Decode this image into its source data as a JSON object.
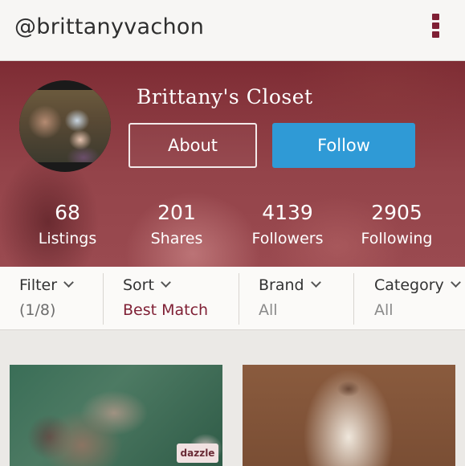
{
  "header": {
    "username": "@brittanyvachon",
    "menu_icon": "kebab-menu-icon"
  },
  "profile": {
    "closet_title": "Brittany's Closet",
    "about_label": "About",
    "follow_label": "Follow",
    "follow_color": "#2f9ad6",
    "accent_color": "#7f1f34"
  },
  "stats": [
    {
      "value": "68",
      "label": "Listings"
    },
    {
      "value": "201",
      "label": "Shares"
    },
    {
      "value": "4139",
      "label": "Followers"
    },
    {
      "value": "2905",
      "label": "Following"
    }
  ],
  "filters": [
    {
      "label": "Filter",
      "value": "(1/8)"
    },
    {
      "label": "Sort",
      "value": "Best Match"
    },
    {
      "label": "Brand",
      "value": "All"
    },
    {
      "label": "Category",
      "value": "All"
    }
  ],
  "listings": [
    {
      "tag": "dazzle"
    },
    {
      "tag": ""
    }
  ]
}
